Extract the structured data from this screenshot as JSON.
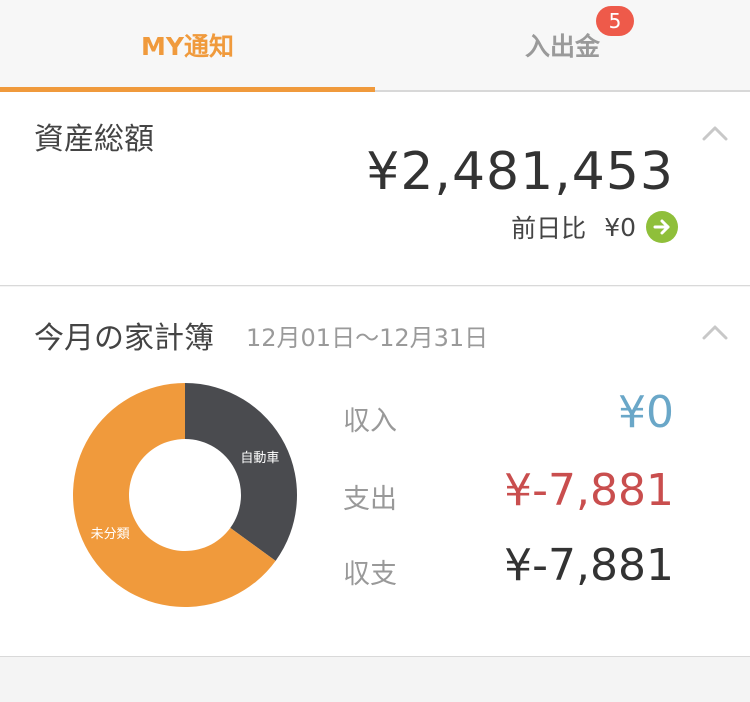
{
  "tabs": [
    {
      "label": "MY通知",
      "active": true
    },
    {
      "label": "入出金",
      "badge": "5"
    }
  ],
  "assets": {
    "title": "資産総額",
    "total": "¥2,481,453",
    "diff_label": "前日比",
    "diff_value": "¥0"
  },
  "household": {
    "title": "今月の家計簿",
    "period": "12月01日〜12月31日",
    "chart_data": {
      "type": "pie",
      "categories": [
        "自動車",
        "未分類"
      ],
      "values": [
        35,
        65
      ],
      "colors": [
        "#4a4b4f",
        "#f09a3c"
      ]
    },
    "rows": [
      {
        "label": "収入",
        "value": "¥0"
      },
      {
        "label": "支出",
        "value": "¥-7,881"
      },
      {
        "label": "収支",
        "value": "¥-7,881"
      }
    ]
  },
  "colors": {
    "accent": "#f09a3c",
    "income": "#6aa7c8",
    "expense": "#c94e4e",
    "badge": "#ee5a4a",
    "arrow": "#8fbf3a"
  },
  "icons": [
    "chevron-up-icon",
    "arrow-right-icon"
  ]
}
